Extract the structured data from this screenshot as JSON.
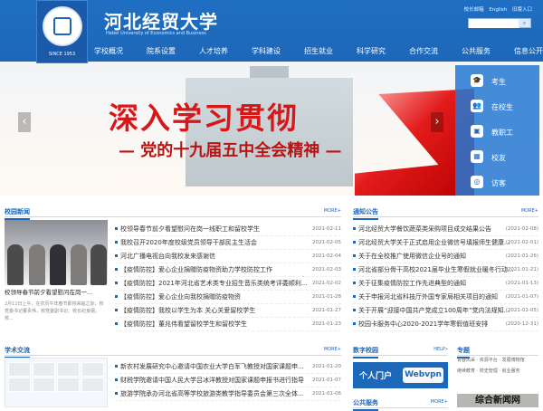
{
  "brand": {
    "name_cn": "河北经贸大学",
    "name_en": "Hebei University of Economics and Business",
    "since": "SINCE 1953"
  },
  "toplinks": [
    "校长邮箱",
    "English",
    "旧版入口"
  ],
  "search": {
    "placeholder": "",
    "button": "⌕"
  },
  "nav": [
    "学校概况",
    "院系设置",
    "人才培养",
    "学科建设",
    "招生就业",
    "科学研究",
    "合作交流",
    "公共服务",
    "信息公开"
  ],
  "banner": {
    "title": "深入学习贯彻",
    "subtitle": "— 党的十九届五中全会精神 —"
  },
  "side": [
    {
      "icon": "🎓",
      "label": "考生"
    },
    {
      "icon": "👥",
      "label": "在校生"
    },
    {
      "icon": "▣",
      "label": "教职工"
    },
    {
      "icon": "▦",
      "label": "校友"
    },
    {
      "icon": "◎",
      "label": "访客"
    }
  ],
  "campus_news": {
    "title": "校园新闻",
    "more": "MORE+",
    "feature_caption": "校领导春节前夕看望慰问在岗一...",
    "feature_excerpt": "2月11日上午，在农历牛年春节即将来临之际，校党委书记董贵伟，校党委副书记、校长纪良纲，校...",
    "items": [
      {
        "text": "校领导春节前夕看望慰问在岗一线职工和留校学生",
        "date": "2021-02-11"
      },
      {
        "text": "我校召开2020年度校级党员领导干部民主生活会",
        "date": "2021-02-05"
      },
      {
        "text": "河北广播电视台向我校发来感谢信",
        "date": "2021-02-04"
      },
      {
        "text": "【疫情防控】爱心企业捐赠防疫物资助力学校防控工作",
        "date": "2021-02-03"
      },
      {
        "text": "【疫情防控】2021年河北省艺术类专业招生音乐类统考评委顺利...",
        "date": "2021-02-02"
      },
      {
        "text": "【疫情防控】爱心企业向我校捐赠防疫物资",
        "date": "2021-01-28"
      },
      {
        "text": "【疫情防控】我校以学生为本 关心关爱留校学生",
        "date": "2021-01-27"
      },
      {
        "text": "【疫情防控】董兆伟看望留校学生和留校学生",
        "date": "2021-01-23"
      }
    ]
  },
  "notices": {
    "title": "通知公告",
    "more": "MORE+",
    "items": [
      {
        "text": "河北经贸大学餐饮蔬菜类采购项目成交结果公告",
        "date": "(2021-02-08)"
      },
      {
        "text": "河北经贸大学关于正式启用企业微信号填报师生健康...",
        "date": "(2021-02-01)"
      },
      {
        "text": "关于在全校推广使用微信企业号的通知",
        "date": "(2021-01-26)"
      },
      {
        "text": "河北省部分骨干高校2021届毕业生寒假就业暖冬行动...",
        "date": "(2021-01-21)"
      },
      {
        "text": "关于征集疫情防控工作先进典型的通知",
        "date": "(2021-01-13)"
      },
      {
        "text": "关于申报河北省科技厅外国专家局相关项目的通知",
        "date": "(2021-01-07)"
      },
      {
        "text": "关于开展“迎接中国共产党成立100周年”党内法规知...",
        "date": "(2021-01-05)"
      },
      {
        "text": "校园卡服务中心2020-2021学年寒假值班安排",
        "date": "(2020-12-31)"
      }
    ]
  },
  "academic": {
    "title": "学术交流",
    "more": "MORE+",
    "items": [
      {
        "text": "新农村发展研究中心邀请中国农业大学白军飞教授对国家课题申...",
        "date": "2021-01-20"
      },
      {
        "text": "财税学院邀请中国人民大学吕冰洋教授对国家课题申报书进行指导",
        "date": "2021-01-07"
      },
      {
        "text": "旅游学院承办河北省高等学校旅游类教学指导委员会第三次全体...",
        "date": "2021-01-06"
      }
    ]
  },
  "digital": {
    "title": "数字校园",
    "more": "HELP»",
    "label": "个人门户",
    "vpn": "Webvpn"
  },
  "public": {
    "title": "公共服务",
    "more": "MORE+"
  },
  "topic": {
    "title": "专题",
    "links": [
      "青春风采",
      "资源平台",
      "发展博物馆",
      "继续教育",
      "校史管理",
      "就业服务"
    ]
  },
  "bottom_banner": "综合新闻网"
}
